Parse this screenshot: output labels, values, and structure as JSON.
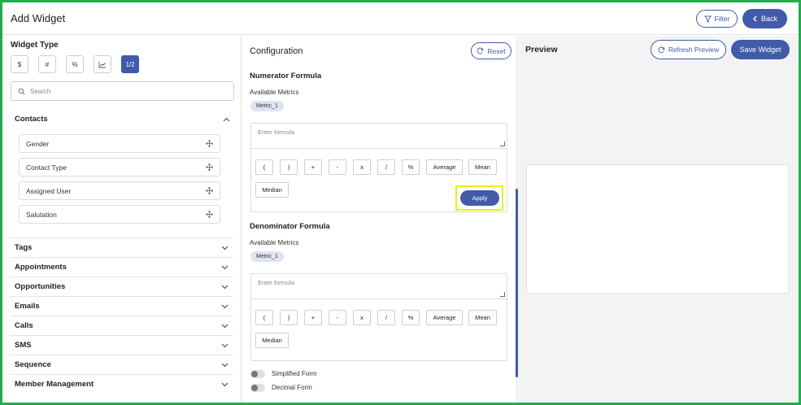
{
  "header": {
    "title": "Add Widget",
    "filter_label": "Filter",
    "back_label": "Back"
  },
  "left": {
    "widget_type_title": "Widget Type",
    "types": [
      "$",
      "#",
      "%",
      "chart",
      "1/2"
    ],
    "active_type": "1/2",
    "search_placeholder": "Search",
    "contacts": {
      "label": "Contacts",
      "fields": [
        "Gender",
        "Contact Type",
        "Assigned User",
        "Salutation"
      ]
    },
    "groups": [
      "Tags",
      "Appointments",
      "Opportunities",
      "Emails",
      "Calls",
      "SMS",
      "Sequence",
      "Member Management"
    ]
  },
  "config": {
    "title": "Configuration",
    "reset_label": "Reset",
    "numerator": {
      "title": "Numerator Formula",
      "available_label": "Available Metrics",
      "metric": "Metric_1",
      "placeholder": "Enter formula",
      "apply_label": "Apply"
    },
    "denominator": {
      "title": "Denominator Formula",
      "available_label": "Available Metrics",
      "metric": "Metric_1",
      "placeholder": "Enter formula"
    },
    "operators": [
      "(",
      ")",
      "+",
      "-",
      "x",
      "/",
      "%",
      "Average",
      "Mean"
    ],
    "operator_row2": [
      "Median"
    ],
    "toggles": [
      "Simplified Form",
      "Decimal Form"
    ]
  },
  "preview": {
    "title": "Preview",
    "refresh_label": "Refresh Preview",
    "save_label": "Save Widget"
  },
  "colors": {
    "accent": "#3f5ba9",
    "frame": "#1fae4b",
    "highlight": "#f0ee13"
  }
}
